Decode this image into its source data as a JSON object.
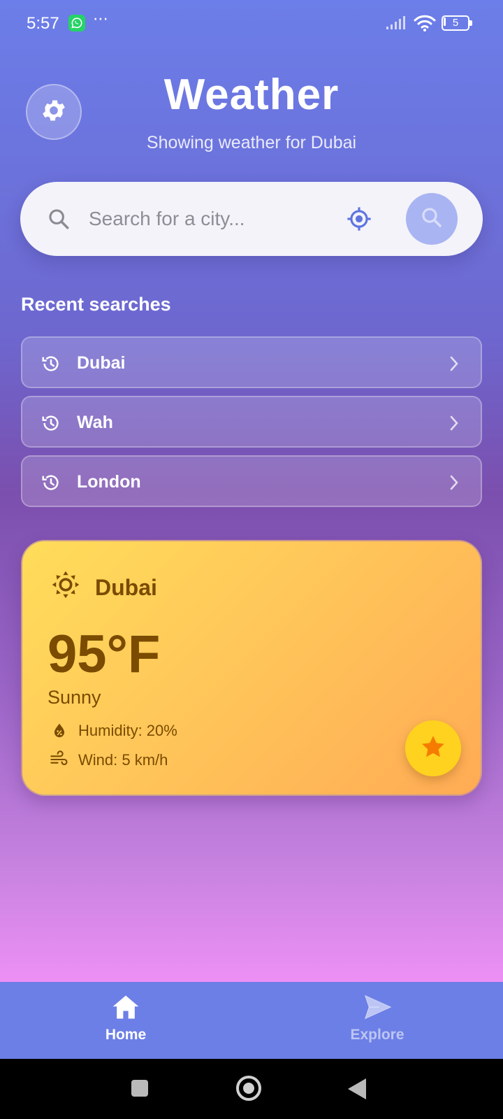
{
  "status_bar": {
    "time": "5:57",
    "more_icon": "⋯",
    "battery_level": "5"
  },
  "header": {
    "title": "Weather",
    "subtitle": "Showing weather for Dubai"
  },
  "search": {
    "placeholder": "Search for a city...",
    "value": ""
  },
  "recent": {
    "title": "Recent searches",
    "items": [
      {
        "label": "Dubai"
      },
      {
        "label": "Wah"
      },
      {
        "label": "London"
      }
    ]
  },
  "card": {
    "city": "Dubai",
    "temperature": "95°F",
    "condition": "Sunny",
    "humidity": "Humidity: 20%",
    "wind": "Wind: 5 km/h"
  },
  "nav": {
    "home_label": "Home",
    "explore_label": "Explore"
  },
  "colors": {
    "accent": "#6c7fe6",
    "card_gradient_start": "#ffdd5a",
    "card_gradient_end": "#ffab55",
    "card_text": "#7a4b00",
    "favorite": "#ffd21f"
  },
  "icons": [
    "whatsapp-icon",
    "signal-icon",
    "wifi-icon",
    "battery-icon",
    "gear-icon",
    "search-icon",
    "locate-icon",
    "history-icon",
    "chevron-right-icon",
    "sun-icon",
    "drop-icon",
    "wind-icon",
    "star-icon",
    "home-icon",
    "send-icon"
  ]
}
